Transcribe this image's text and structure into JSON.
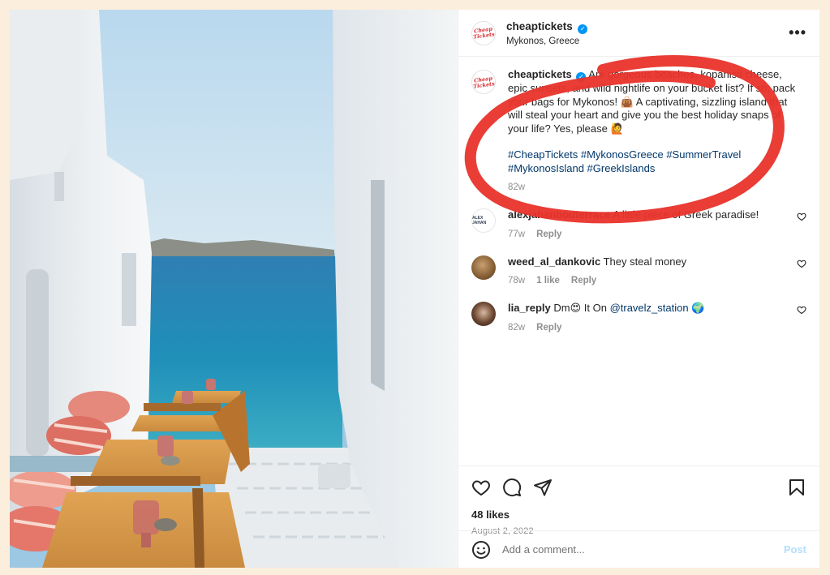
{
  "header": {
    "avatar_text": "Cheap Tickets",
    "username": "cheaptickets",
    "location": "Mykonos, Greece",
    "more_icon": "more-horizontal-icon"
  },
  "caption": {
    "username": "cheaptickets",
    "text": "Are gorgeous beaches, kopanisti cheese, epic sunsets, and wild nightlife on your bucket list? If so, pack your bags for Mykonos! 👜 A captivating, sizzling island that will steal your heart and give you the best holiday snaps of your life? Yes, please 🙋",
    "hashtags": "#CheapTickets #MykonosGreece #SummerTravel #MykonosIsland #GreekIslands",
    "time": "82w"
  },
  "comments": [
    {
      "username": "alexjahanbouterrace",
      "text": "A little piece of Greek paradise!",
      "time": "77w",
      "likes": "",
      "reply": "Reply",
      "avatar_text": "ALEX JAHAN"
    },
    {
      "username": "weed_al_dankovic",
      "text": "They steal money",
      "time": "78w",
      "likes": "1 like",
      "reply": "Reply"
    },
    {
      "username": "lia_reply",
      "text_before": "Dm😍 It On ",
      "mention": "@travelz_station",
      "text_after": " 🌍",
      "time": "82w",
      "likes": "",
      "reply": "Reply"
    }
  ],
  "actions": {
    "like_icon": "heart-icon",
    "comment_icon": "comment-icon",
    "share_icon": "share-icon",
    "save_icon": "bookmark-icon",
    "likes": "48 likes",
    "date": "August 2, 2022"
  },
  "composer": {
    "emoji_icon": "emoji-icon",
    "placeholder": "Add a comment...",
    "post_label": "Post"
  },
  "colors": {
    "annotation_red": "#e8332b",
    "link_blue": "#00376b",
    "verified_blue": "#0095f6",
    "page_background": "#fbeedd"
  }
}
